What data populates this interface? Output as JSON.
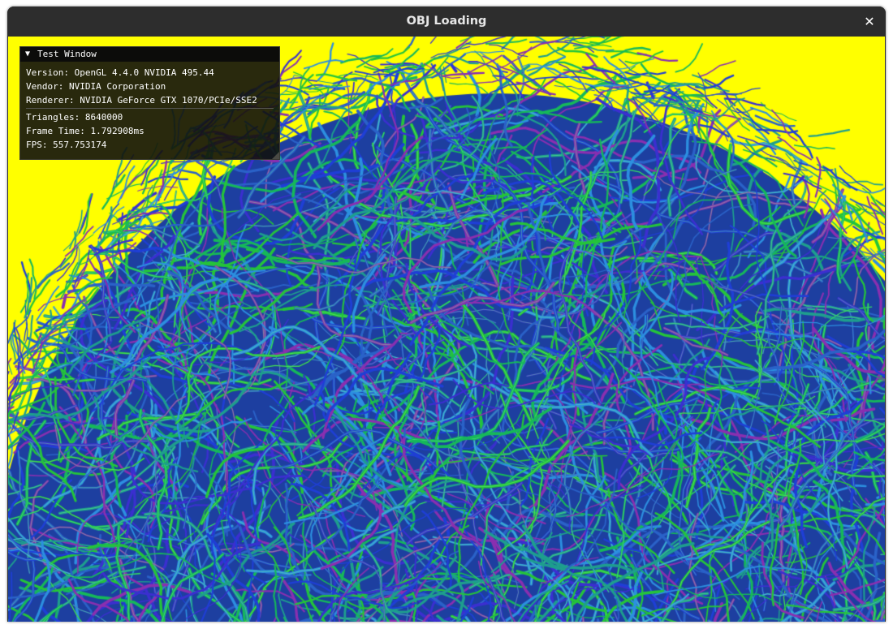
{
  "window": {
    "title": "OBJ Loading",
    "close_glyph": "✕",
    "background_color": "#ffff00"
  },
  "imgui_panel": {
    "title": "Test Window",
    "collapse_glyph": "▼",
    "version": "Version: OpenGL 4.4.0 NVIDIA 495.44",
    "vendor": "Vendor: NVIDIA Corporation",
    "renderer": "Renderer: NVIDIA GeForce GTX 1070/PCIe/SSE2",
    "triangles": "Triangles: 8640000",
    "frame_time": "Frame Time: 1.792908ms",
    "fps": "FPS: 557.753174"
  },
  "scene": {
    "description_icon": "hair-ball-mesh",
    "strand_colors": [
      "#1f3fd6",
      "#2a62c8",
      "#1e9e8e",
      "#25c43a",
      "#3b2fd0",
      "#8a2fb0",
      "#2c8fe0",
      "#16b85a"
    ]
  }
}
